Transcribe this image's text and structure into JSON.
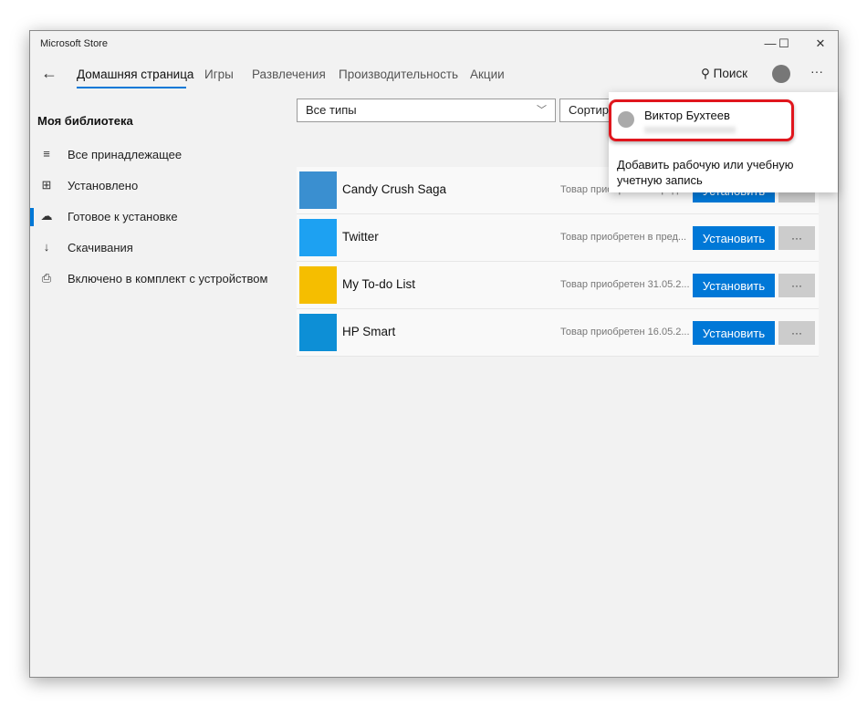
{
  "window": {
    "title": "Microsoft Store",
    "minimize": "—",
    "maximize": "☐",
    "close": "✕"
  },
  "nav": {
    "back": "←",
    "tabs": [
      "Домашняя страница",
      "Игры",
      "Развлечения",
      "Производительность",
      "Акции"
    ],
    "search": "Поиск",
    "more": "···"
  },
  "sidebar": {
    "heading": "Моя библиотека",
    "items": [
      {
        "label": "Все принадлежащее",
        "icon": "≡"
      },
      {
        "label": "Установлено",
        "icon": "⊞"
      },
      {
        "label": "Готовое к установке",
        "icon": "☁"
      },
      {
        "label": "Скачивания",
        "icon": "↓"
      },
      {
        "label": "Включено в комплект с устройством",
        "icon": "⎙"
      }
    ]
  },
  "filters": {
    "type": "Все типы",
    "sort": "Сортир"
  },
  "apps": [
    {
      "name": "Candy Crush Saga",
      "status": "Товар приобретен в пред...",
      "install": "Установить",
      "more": "···",
      "color": "#3a8fd0"
    },
    {
      "name": "Twitter",
      "status": "Товар приобретен в пред...",
      "install": "Установить",
      "more": "···",
      "color": "#1da1f2"
    },
    {
      "name": "My To-do List",
      "status": "Товар приобретен 31.05.2...",
      "install": "Установить",
      "more": "···",
      "color": "#f5be00"
    },
    {
      "name": "HP Smart",
      "status": "Товар приобретен 16.05.2...",
      "install": "Установить",
      "more": "···",
      "color": "#0d8fd6"
    }
  ],
  "account_menu": {
    "user": "Виктор Бухтеев",
    "add_account": "Добавить рабочую или учебную учетную запись"
  }
}
